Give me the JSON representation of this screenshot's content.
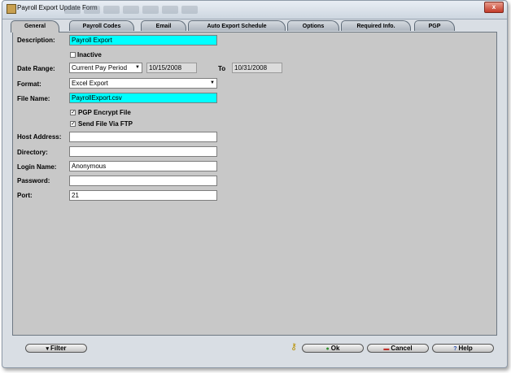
{
  "window": {
    "title": "Payroll Export Update Form",
    "close_glyph": "x"
  },
  "tabs": [
    {
      "label": "General",
      "active": true
    },
    {
      "label": "Payroll Codes",
      "active": false
    },
    {
      "label": "Email",
      "active": false
    },
    {
      "label": "Auto Export Schedule",
      "active": false
    },
    {
      "label": "Options",
      "active": false
    },
    {
      "label": "Required Info.",
      "active": false
    },
    {
      "label": "PGP",
      "active": false
    }
  ],
  "form": {
    "description_label": "Description:",
    "description_value": "Payroll Export",
    "inactive_label": "Inactive",
    "inactive_checked": false,
    "date_range_label": "Date Range:",
    "date_range_value": "Current Pay Period",
    "date_from": "10/15/2008",
    "to_label": "To",
    "date_to": "10/31/2008",
    "format_label": "Format:",
    "format_value": "Excel Export",
    "file_name_label": "File Name:",
    "file_name_value": "PayrollExport.csv",
    "pgp_encrypt_label": "PGP Encrypt File",
    "pgp_encrypt_checked": true,
    "ftp_label": "Send File Via FTP",
    "ftp_checked": true,
    "host_label": "Host Address:",
    "host_value": "",
    "directory_label": "Directory:",
    "directory_value": "",
    "login_label": "Login Name:",
    "login_value": "Anonymous",
    "password_label": "Password:",
    "password_value": "",
    "port_label": "Port:",
    "port_value": "21"
  },
  "buttons": {
    "filter": "Filter",
    "ok": "Ok",
    "cancel": "Cancel",
    "help": "Help"
  },
  "colors": {
    "highlight_field": "#00ffff",
    "panel": "#c8c8c8"
  }
}
